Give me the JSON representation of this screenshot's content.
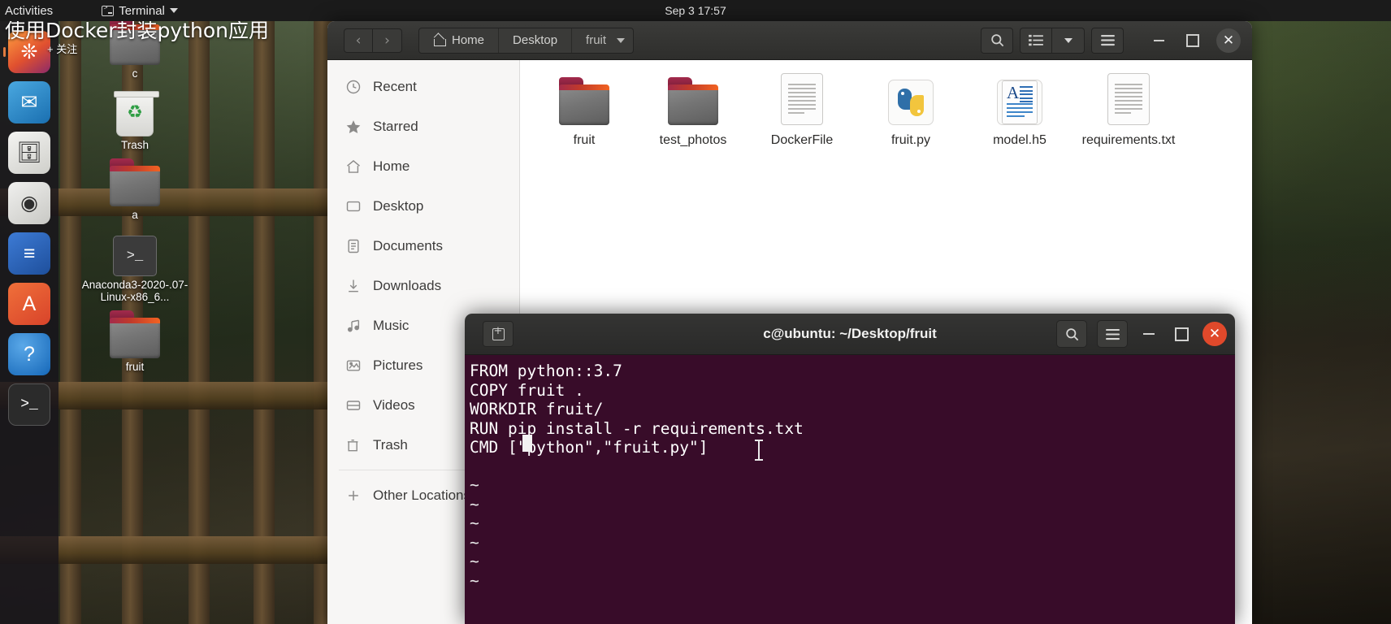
{
  "topbar": {
    "activities": "Activities",
    "app_name": "Terminal",
    "app_icon": "terminal-icon",
    "app_caret": "chevron-down-icon",
    "clock": "Sep 3  17:57"
  },
  "overlay": {
    "title": "使用Docker封装python应用",
    "follow_label": "+ 关注"
  },
  "dock": {
    "items": [
      {
        "name": "firefox",
        "glyph": "◑"
      },
      {
        "name": "thunderbird",
        "glyph": "✉"
      },
      {
        "name": "files",
        "glyph": "🗀"
      },
      {
        "name": "rhythmbox",
        "glyph": "◉"
      },
      {
        "name": "libreoffice-writer",
        "glyph": "≡"
      },
      {
        "name": "ubuntu-software",
        "glyph": "A"
      },
      {
        "name": "help",
        "glyph": "?"
      },
      {
        "name": "terminal",
        "glyph": ">_"
      }
    ]
  },
  "desktop_icons": [
    {
      "label": "c",
      "type": "folder"
    },
    {
      "label": "Trash",
      "type": "trash"
    },
    {
      "label": "a",
      "type": "folder"
    },
    {
      "label": "Anaconda3-2020-.07-Linux-x86_6...",
      "type": "terminal-script"
    },
    {
      "label": "fruit",
      "type": "folder"
    }
  ],
  "files_window": {
    "nav": {
      "back": "‹",
      "forward": "›"
    },
    "breadcrumbs": [
      {
        "label": "Home",
        "icon": "home-icon"
      },
      {
        "label": "Desktop",
        "icon": ""
      },
      {
        "label": "fruit",
        "icon": ""
      }
    ],
    "toolbar": {
      "search": "search-icon",
      "view_list": "list-view-icon",
      "view_caret": "chevron-down-icon",
      "menu": "hamburger-menu-icon"
    },
    "window_controls": {
      "minimize": "–",
      "maximize": "□",
      "close": "✕"
    },
    "sidebar": {
      "items": [
        {
          "label": "Recent",
          "icon": "clock-icon"
        },
        {
          "label": "Starred",
          "icon": "star-icon"
        },
        {
          "label": "Home",
          "icon": "home-icon"
        },
        {
          "label": "Desktop",
          "icon": "desktop-icon"
        },
        {
          "label": "Documents",
          "icon": "documents-icon"
        },
        {
          "label": "Downloads",
          "icon": "download-icon"
        },
        {
          "label": "Music",
          "icon": "music-note-icon"
        },
        {
          "label": "Pictures",
          "icon": "picture-icon"
        },
        {
          "label": "Videos",
          "icon": "video-icon"
        },
        {
          "label": "Trash",
          "icon": "trash-icon"
        }
      ],
      "other_locations": {
        "label": "Other Locations",
        "icon": "plus-icon"
      }
    },
    "files": [
      {
        "name": "fruit",
        "type": "folder"
      },
      {
        "name": "test_photos",
        "type": "folder"
      },
      {
        "name": "DockerFile",
        "type": "text-document"
      },
      {
        "name": "fruit.py",
        "type": "python-script"
      },
      {
        "name": "model.h5",
        "type": "text-document-a"
      },
      {
        "name": "requirements.txt",
        "type": "text-document"
      }
    ]
  },
  "terminal_window": {
    "title": "c@ubuntu: ~/Desktop/fruit",
    "new_tab_icon": "new-tab-icon",
    "search_icon": "search-icon",
    "menu_icon": "hamburger-menu-icon",
    "window_controls": {
      "minimize": "–",
      "maximize": "□",
      "close": "✕"
    },
    "content_lines": [
      "FROM python::3.7",
      "COPY fruit .",
      "WORKDIR fruit/",
      "RUN pip install -r requirements.txt",
      "CMD [\"python\",\"fruit.py\"]"
    ],
    "empty_markers": [
      "~",
      "~",
      "~",
      "~",
      "~",
      "~"
    ]
  },
  "colors": {
    "terminal_bg": "#380c29",
    "close_red": "#e0492b",
    "folder_accent": "#f26322",
    "accent_green": "#2f9e44"
  }
}
